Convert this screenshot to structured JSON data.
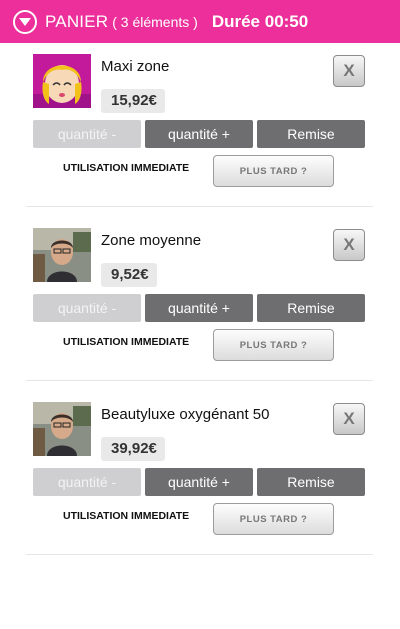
{
  "header": {
    "title": "PANIER",
    "count": "( 3 éléments )",
    "timer": "Durée 00:50",
    "toggle_icon": "chevron-down-circle-icon",
    "background_color": "#ec2f9a"
  },
  "cart": {
    "items": [
      {
        "name": "Maxi zone",
        "price": "15,92€",
        "thumbnail": "cartoon-blonde-girl-avatar",
        "remove_label": "X",
        "qty_minus_label": "quantité -",
        "qty_plus_label": "quantité +",
        "discount_label": "Remise",
        "usage_label": "UTILISATION IMMEDIATE",
        "later_label": "PLUS TARD ?"
      },
      {
        "name": "Zone moyenne",
        "price": "9,52€",
        "thumbnail": "man-photo-thumbnail",
        "remove_label": "X",
        "qty_minus_label": "quantité -",
        "qty_plus_label": "quantité +",
        "discount_label": "Remise",
        "usage_label": "UTILISATION IMMEDIATE",
        "later_label": "PLUS TARD ?"
      },
      {
        "name": "Beautyluxe oxygénant 50",
        "price": "39,92€",
        "thumbnail": "man-photo-thumbnail",
        "remove_label": "X",
        "qty_minus_label": "quantité -",
        "qty_plus_label": "quantité +",
        "discount_label": "Remise",
        "usage_label": "UTILISATION IMMEDIATE",
        "later_label": "PLUS TARD ?"
      }
    ]
  },
  "colors": {
    "accent": "#ec2f9a",
    "button_dark": "#6e6e70",
    "button_disabled": "#cfcfd2",
    "price_badge": "#e9e9e9"
  }
}
